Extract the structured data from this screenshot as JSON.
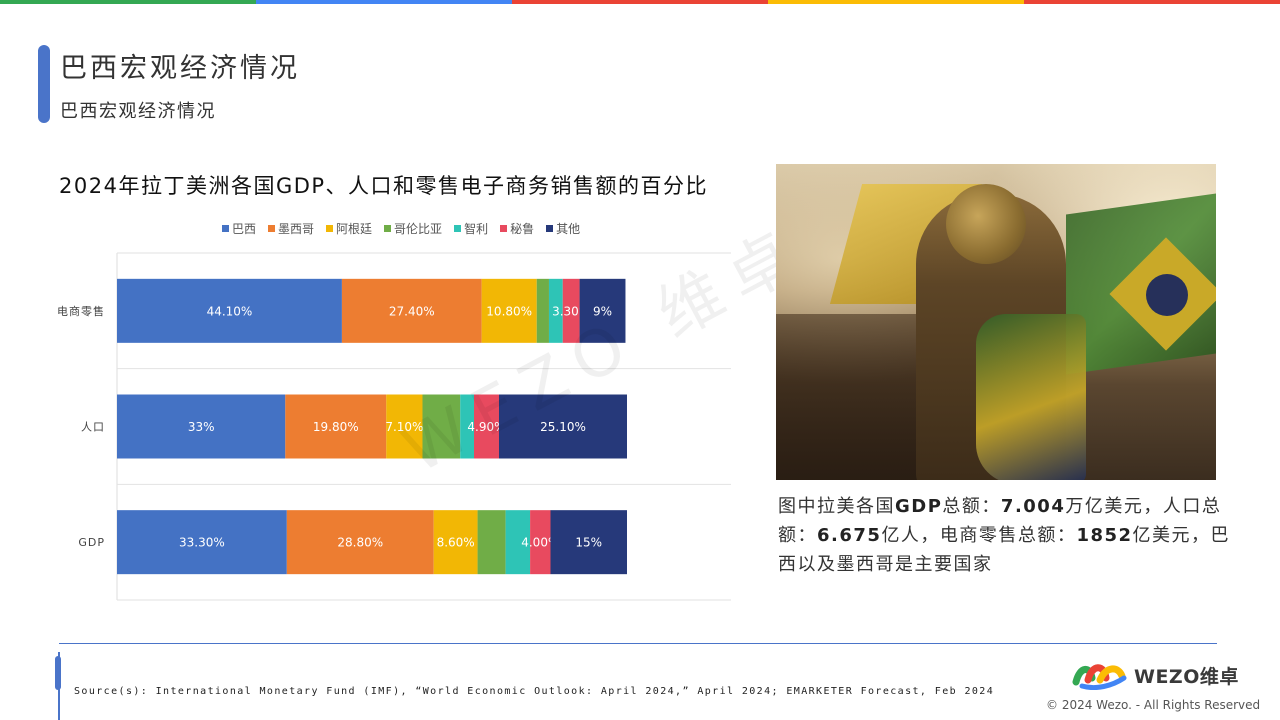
{
  "top_bar_colors": [
    "#34a853",
    "#4285f4",
    "#ea4335",
    "#fbbc05",
    "#ea4335"
  ],
  "header": {
    "title": "巴西宏观经济情况",
    "subtitle": "巴西宏观经济情况"
  },
  "watermark": "WEZO 维卓",
  "chart_data": {
    "type": "bar",
    "orientation": "horizontal",
    "stacked": true,
    "title": "2024年拉丁美洲各国GDP、人口和零售电子商务销售额的百分比",
    "categories": [
      "电商零售",
      "人口",
      "GDP"
    ],
    "legend_position": "top",
    "series": [
      {
        "name": "巴西",
        "color": "#4472c4",
        "values": [
          44.1,
          33.0,
          33.3
        ],
        "labels": [
          "44.10%",
          "33%",
          "33.30%"
        ]
      },
      {
        "name": "墨西哥",
        "color": "#ed7d31",
        "values": [
          27.4,
          19.8,
          28.8
        ],
        "labels": [
          "27.40%",
          "19.80%",
          "28.80%"
        ]
      },
      {
        "name": "阿根廷",
        "color": "#f2b705",
        "values": [
          10.8,
          7.1,
          8.6
        ],
        "labels": [
          "10.80%",
          "7.10%",
          "8.60%"
        ]
      },
      {
        "name": "哥伦比亚",
        "color": "#70ad47",
        "values": [
          2.4,
          7.4,
          5.5
        ],
        "labels": [
          "",
          "",
          ""
        ]
      },
      {
        "name": "智利",
        "color": "#2ec4b6",
        "values": [
          2.7,
          2.7,
          4.8
        ],
        "labels": [
          "",
          "",
          ""
        ]
      },
      {
        "name": "秘鲁",
        "color": "#e84a5f",
        "values": [
          3.3,
          4.9,
          4.0
        ],
        "labels": [
          "3.30%",
          "4.90%",
          "4.00%"
        ]
      },
      {
        "name": "其他",
        "color": "#26397a",
        "values": [
          9.0,
          25.1,
          15.0
        ],
        "labels": [
          "9%",
          "25.10%",
          "15%"
        ]
      }
    ]
  },
  "caption": {
    "p1": "图中拉美各国",
    "gdp_label": "GDP",
    "p2": "总额：",
    "gdp_value": "7.004",
    "p3": "万亿美元，人口总额：",
    "pop_value": "6.675",
    "p4": "亿人，电商零售总额：",
    "ecom_value": "1852",
    "p5": "亿美元，巴西以及墨西哥是主要国家"
  },
  "footer": {
    "source": "Source(s): International Monetary Fund (IMF), “World Economic Outlook: April 2024,” April 2024; EMARKETER Forecast, Feb 2024",
    "logo_text": "WEZO维卓",
    "copyright": "© 2024 Wezo. - All Rights Reserved"
  }
}
